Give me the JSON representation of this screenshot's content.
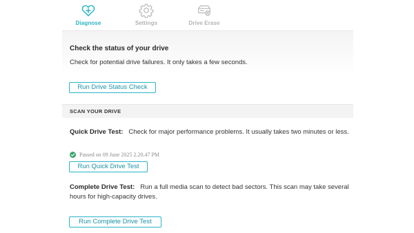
{
  "tabs": [
    {
      "label": "Diagnose",
      "icon": "heart-plus-icon",
      "active": true
    },
    {
      "label": "Settings",
      "icon": "gear-icon",
      "active": false
    },
    {
      "label": "Drive Erase",
      "icon": "drive-erase-icon",
      "active": false
    }
  ],
  "status_check": {
    "title": "Check the status of your drive",
    "description": "Check for potential drive failures. It only takes a few seconds.",
    "button_label": "Run Drive Status Check"
  },
  "scan": {
    "header": "SCAN YOUR DRIVE",
    "quick": {
      "name": "Quick Drive Test:",
      "description": "Check for major performance problems. It usually takes two minutes or less.",
      "result": "Passed on 09 June 2025 2.20.47 PM",
      "button_label": "Run Quick Drive Test"
    },
    "complete": {
      "name": "Complete Drive Test:",
      "description": "Run a full media scan to detect bad sectors. This scan may take several hours for high-capacity drives.",
      "button_label": "Run Complete Drive Test"
    }
  },
  "colors": {
    "accent": "#29b3c6",
    "success": "#3aa46a",
    "inactive": "#b3b3b3"
  }
}
